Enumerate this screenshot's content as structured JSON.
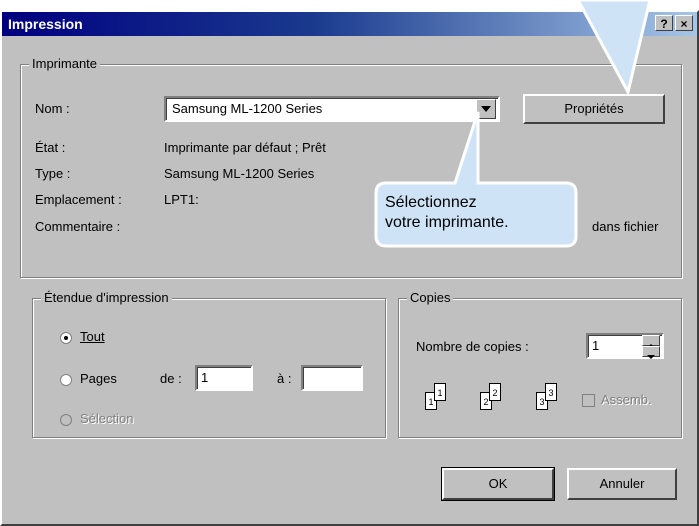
{
  "window": {
    "title": "Impression",
    "help_button": "?",
    "close_button": "×"
  },
  "printer_group": {
    "legend": "Imprimante",
    "name_label": "Nom :",
    "name_value": "Samsung ML-1200 Series",
    "properties_button": "Propriétés",
    "status_label": "État :",
    "status_value": "Imprimante par défaut ; Prêt",
    "type_label": "Type :",
    "type_value": "Samsung ML-1200 Series",
    "location_label": "Emplacement :",
    "location_value": "LPT1:",
    "comment_label": "Commentaire :",
    "print_to_file_partial": "dans fichier"
  },
  "range_group": {
    "legend": "Étendue d'impression",
    "all_label": "Tout",
    "pages_label": "Pages",
    "from_label": "de :",
    "from_value": "1",
    "to_label": "à :",
    "to_value": "",
    "selection_label": "Sélection",
    "selected": "Tout"
  },
  "copies_group": {
    "legend": "Copies",
    "count_label": "Nombre de copies :",
    "count_value": "1",
    "collate_label": "Assemb.",
    "collate_checked": false,
    "collate_icons": [
      [
        "1",
        "1"
      ],
      [
        "2",
        "2"
      ],
      [
        "3",
        "3"
      ]
    ]
  },
  "buttons": {
    "ok": "OK",
    "cancel": "Annuler"
  },
  "callout": {
    "line1": "Sélectionnez",
    "line2": "votre imprimante."
  }
}
